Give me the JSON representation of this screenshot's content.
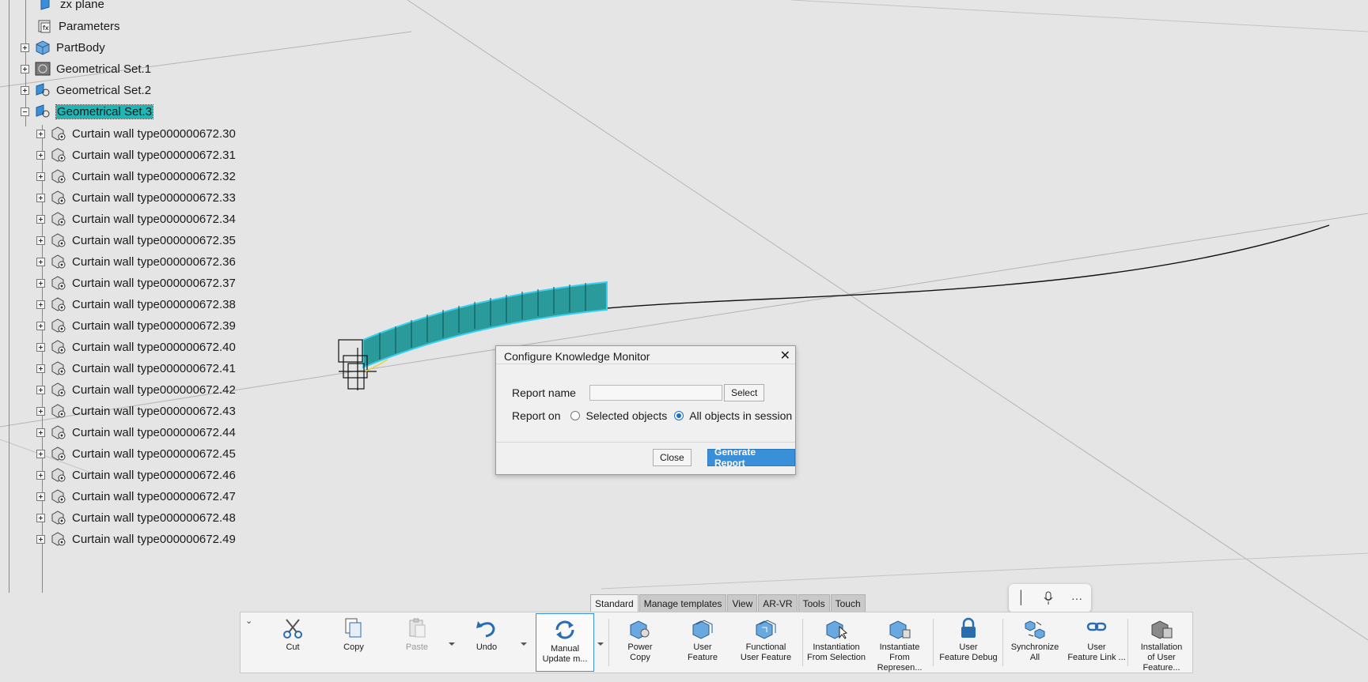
{
  "tree": {
    "top_items": [
      {
        "label": "zx plane"
      },
      {
        "label": "Parameters"
      },
      {
        "label": "PartBody"
      },
      {
        "label": "Geometrical Set.1"
      },
      {
        "label": "Geometrical Set.2"
      },
      {
        "label": "Geometrical Set.3"
      }
    ],
    "children": [
      "Curtain wall type000000672.30",
      "Curtain wall type000000672.31",
      "Curtain wall type000000672.32",
      "Curtain wall type000000672.33",
      "Curtain wall type000000672.34",
      "Curtain wall type000000672.35",
      "Curtain wall type000000672.36",
      "Curtain wall type000000672.37",
      "Curtain wall type000000672.38",
      "Curtain wall type000000672.39",
      "Curtain wall type000000672.40",
      "Curtain wall type000000672.41",
      "Curtain wall type000000672.42",
      "Curtain wall type000000672.43",
      "Curtain wall type000000672.44",
      "Curtain wall type000000672.45",
      "Curtain wall type000000672.46",
      "Curtain wall type000000672.47",
      "Curtain wall type000000672.48",
      "Curtain wall type000000672.49"
    ]
  },
  "dialog": {
    "title": "Configure Knowledge Monitor",
    "close_glyph": "✕",
    "report_name_label": "Report name",
    "report_name_value": "",
    "select_button": "Select",
    "report_on_label": "Report on",
    "option_selected": "Selected objects",
    "option_all": "All objects in session",
    "selected_option": "All objects in session",
    "close_button": "Close",
    "generate_button": "Generate Report"
  },
  "tabs": [
    "Standard",
    "Manage templates",
    "View",
    "AR-VR",
    "Tools",
    "Touch"
  ],
  "active_tab": "Standard",
  "toolbar": {
    "cut": "Cut",
    "copy": "Copy",
    "paste": "Paste",
    "undo": "Undo",
    "manual_update_1": "Manual",
    "manual_update_2": "Update m...",
    "power_copy_1": "Power",
    "power_copy_2": "Copy",
    "user_feature_1": "User",
    "user_feature_2": "Feature",
    "functional_1": "Functional",
    "functional_2": "User Feature",
    "inst_sel_1": "Instantiation",
    "inst_sel_2": "From Selection",
    "inst_rep_1": "Instantiate",
    "inst_rep_2": "From Represen...",
    "debug_1": "User",
    "debug_2": "Feature Debug",
    "sync_1": "Synchronize",
    "sync_2": "All",
    "link_1": "User",
    "link_2": "Feature Link ...",
    "install_1": "Installation",
    "install_2": "of User Feature..."
  },
  "colors": {
    "accent": "#3a8fd9",
    "selection": "#1fb6b5",
    "wall": "#2a9a9a"
  }
}
